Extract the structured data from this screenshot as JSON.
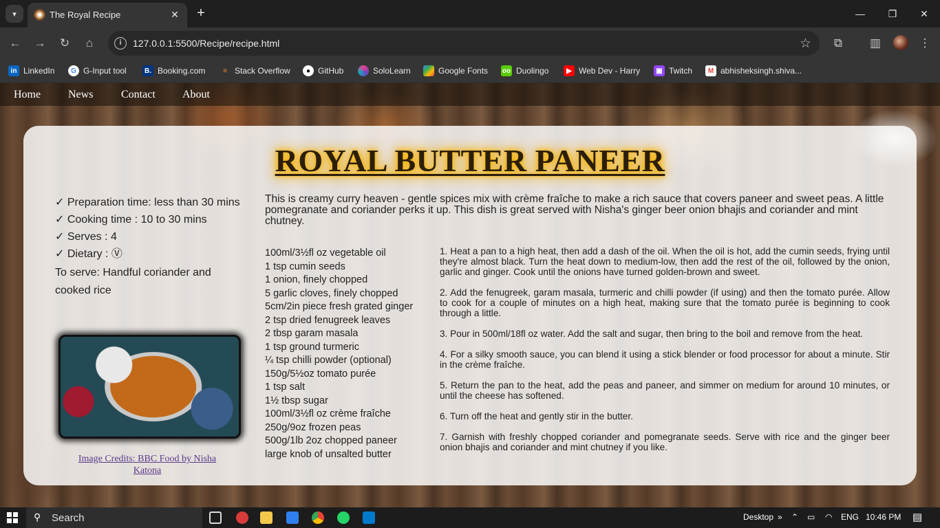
{
  "browser": {
    "tab_title": "The Royal Recipe",
    "url": "127.0.0.1:5500/Recipe/recipe.html",
    "bookmarks": [
      {
        "label": "LinkedIn",
        "icon": "linkedin-icon"
      },
      {
        "label": "G-Input tool",
        "icon": "google-icon"
      },
      {
        "label": "Booking.com",
        "icon": "booking-icon"
      },
      {
        "label": "Stack Overflow",
        "icon": "stackoverflow-icon"
      },
      {
        "label": "GitHub",
        "icon": "github-icon"
      },
      {
        "label": "SoloLearn",
        "icon": "sololearn-icon"
      },
      {
        "label": "Google Fonts",
        "icon": "google-fonts-icon"
      },
      {
        "label": "Duolingo",
        "icon": "duolingo-icon"
      },
      {
        "label": "Web Dev - Harry",
        "icon": "youtube-icon"
      },
      {
        "label": "Twitch",
        "icon": "twitch-icon"
      },
      {
        "label": "abhisheksingh.shiva...",
        "icon": "gmail-icon"
      }
    ]
  },
  "nav": {
    "items": [
      "Home",
      "News",
      "Contact",
      "About"
    ]
  },
  "recipe": {
    "title": "ROYAL BUTTER PANEER",
    "facts": [
      "✓ Preparation time: less than 30 mins",
      "✓ Cooking time : 10 to 30 mins",
      "✓ Serves : 4",
      "✓ Dietary : Ⓥ"
    ],
    "serve": "To serve: Handful coriander and cooked rice",
    "credits": "Image Credits: BBC Food by Nisha Katona",
    "intro": "This is creamy curry heaven - gentle spices mix with crème fraîche to make a rich sauce that covers paneer and sweet peas. A little pomegranate and coriander perks it up. This dish is great served with Nisha's ginger beer onion bhajis and coriander and mint chutney.",
    "ingredients": [
      "100ml/3½fl oz vegetable oil",
      "1 tsp cumin seeds",
      "1 onion, finely chopped",
      "5 garlic cloves, finely chopped",
      "5cm/2in piece fresh grated ginger",
      "2 tsp dried fenugreek leaves",
      "2 tbsp garam masala",
      "1 tsp ground turmeric",
      "¼ tsp chilli powder (optional)",
      "150g/5½oz tomato purée",
      "1 tsp salt",
      "1½ tbsp sugar",
      "100ml/3½fl oz crème fraîche",
      "250g/9oz frozen peas",
      "500g/1lb 2oz chopped paneer",
      "large knob of unsalted butter"
    ],
    "steps": [
      "1. Heat a pan to a high heat, then add a dash of the oil. When the oil is hot, add the cumin seeds, frying until they're almost black. Turn the heat down to medium-low, then add the rest of the oil, followed by the onion, garlic and ginger. Cook until the onions have turned golden-brown and sweet.",
      "2. Add the fenugreek, garam masala, turmeric and chilli powder (if using) and then the tomato purée. Allow to cook for a couple of minutes on a high heat, making sure that the tomato purée is beginning to cook through a little.",
      "3. Pour in 500ml/18fl oz water. Add the salt and sugar, then bring to the boil and remove from the heat.",
      "4. For a silky smooth sauce, you can blend it using a stick blender or food processor for about a minute. Stir in the crème fraîche.",
      "5. Return the pan to the heat, add the peas and paneer, and simmer on medium for around 10 minutes, or until the cheese has softened.",
      "6. Turn off the heat and gently stir in the butter.",
      "7. Garnish with freshly chopped coriander and pomegranate seeds. Serve with rice and the ginger beer onion bhajis and coriander and mint chutney if you like."
    ]
  },
  "taskbar": {
    "search_label": "Search",
    "desktop_label": "Desktop",
    "language": "ENG",
    "time": "10:46 PM"
  }
}
